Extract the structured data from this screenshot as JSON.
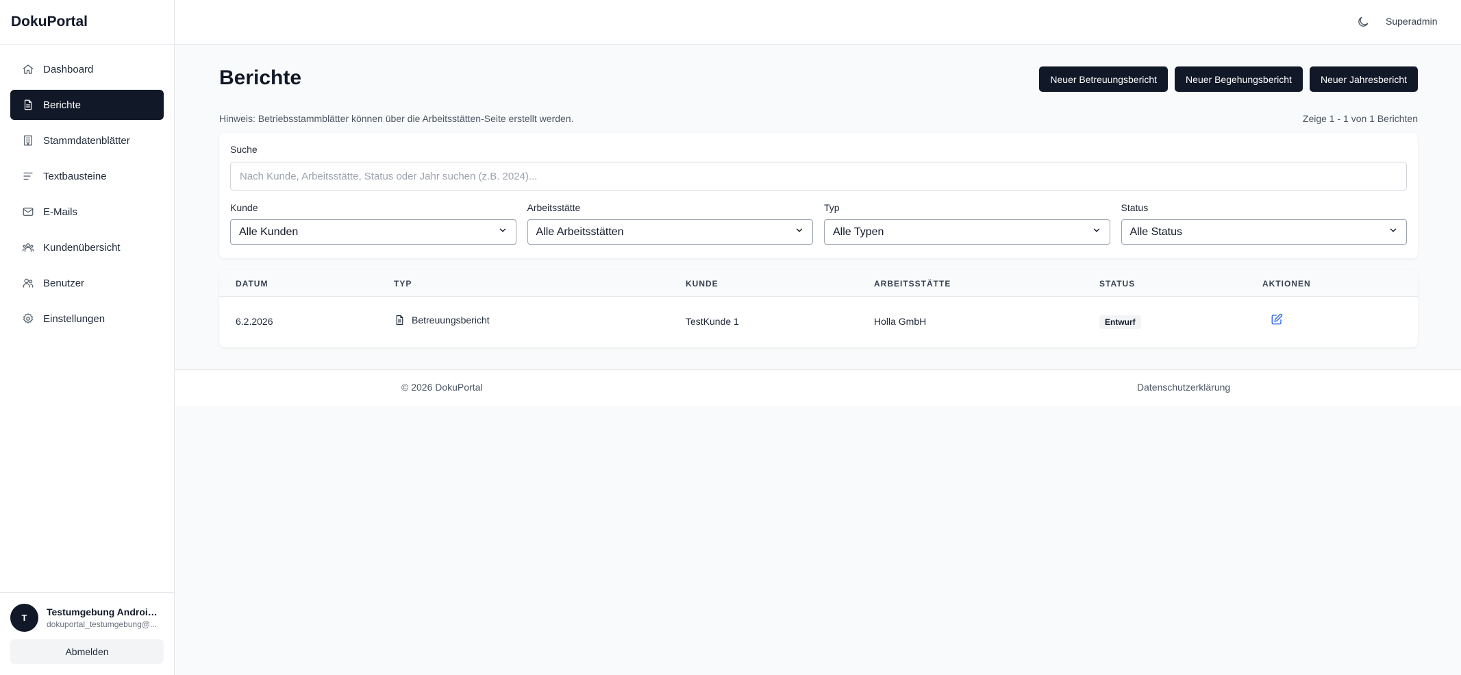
{
  "app": {
    "brand": "DokuPortal"
  },
  "sidebar": {
    "items": [
      {
        "label": "Dashboard",
        "icon": "home-icon"
      },
      {
        "label": "Berichte",
        "icon": "document-icon",
        "active": true
      },
      {
        "label": "Stammdatenblätter",
        "icon": "building-icon"
      },
      {
        "label": "Textbausteine",
        "icon": "text-lines-icon"
      },
      {
        "label": "E-Mails",
        "icon": "mail-icon"
      },
      {
        "label": "Kundenübersicht",
        "icon": "users-group-icon"
      },
      {
        "label": "Benutzer",
        "icon": "user-icon"
      },
      {
        "label": "Einstellungen",
        "icon": "gear-icon"
      }
    ]
  },
  "user": {
    "initial": "T",
    "name": "Testumgebung Androidi...",
    "email": "dokuportal_testumgebung@...",
    "logout_label": "Abmelden"
  },
  "topbar": {
    "role": "Superadmin",
    "theme_icon": "moon-icon"
  },
  "main": {
    "title": "Berichte",
    "buttons": {
      "new_care": "Neuer Betreuungsbericht",
      "new_inspection": "Neuer Begehungsbericht",
      "new_annual": "Neuer Jahresbericht"
    },
    "hint": "Hinweis: Betriebsstammblätter können über die Arbeitsstätten-Seite erstellt werden.",
    "count": "Zeige 1 - 1 von 1 Berichten"
  },
  "filters": {
    "search_label": "Suche",
    "search_placeholder": "Nach Kunde, Arbeitsstätte, Status oder Jahr suchen (z.B. 2024)...",
    "customer": {
      "label": "Kunde",
      "value": "Alle Kunden"
    },
    "workplace": {
      "label": "Arbeitsstätte",
      "value": "Alle Arbeitsstätten"
    },
    "type": {
      "label": "Typ",
      "value": "Alle Typen"
    },
    "status": {
      "label": "Status",
      "value": "Alle Status"
    }
  },
  "table": {
    "headers": {
      "date": "DATUM",
      "type": "TYP",
      "customer": "KUNDE",
      "workplace": "ARBEITSSTÄTTE",
      "status": "STATUS",
      "actions": "AKTIONEN"
    },
    "rows": [
      {
        "date": "6.2.2026",
        "type": "Betreuungsbericht",
        "customer": "TestKunde 1",
        "workplace": "Holla GmbH",
        "status": "Entwurf"
      }
    ]
  },
  "footer": {
    "copyright": "© 2026 DokuPortal",
    "privacy": "Datenschutzerklärung"
  },
  "colors": {
    "primary": "#111827",
    "link": "#2563eb",
    "background": "#f9fafb"
  }
}
